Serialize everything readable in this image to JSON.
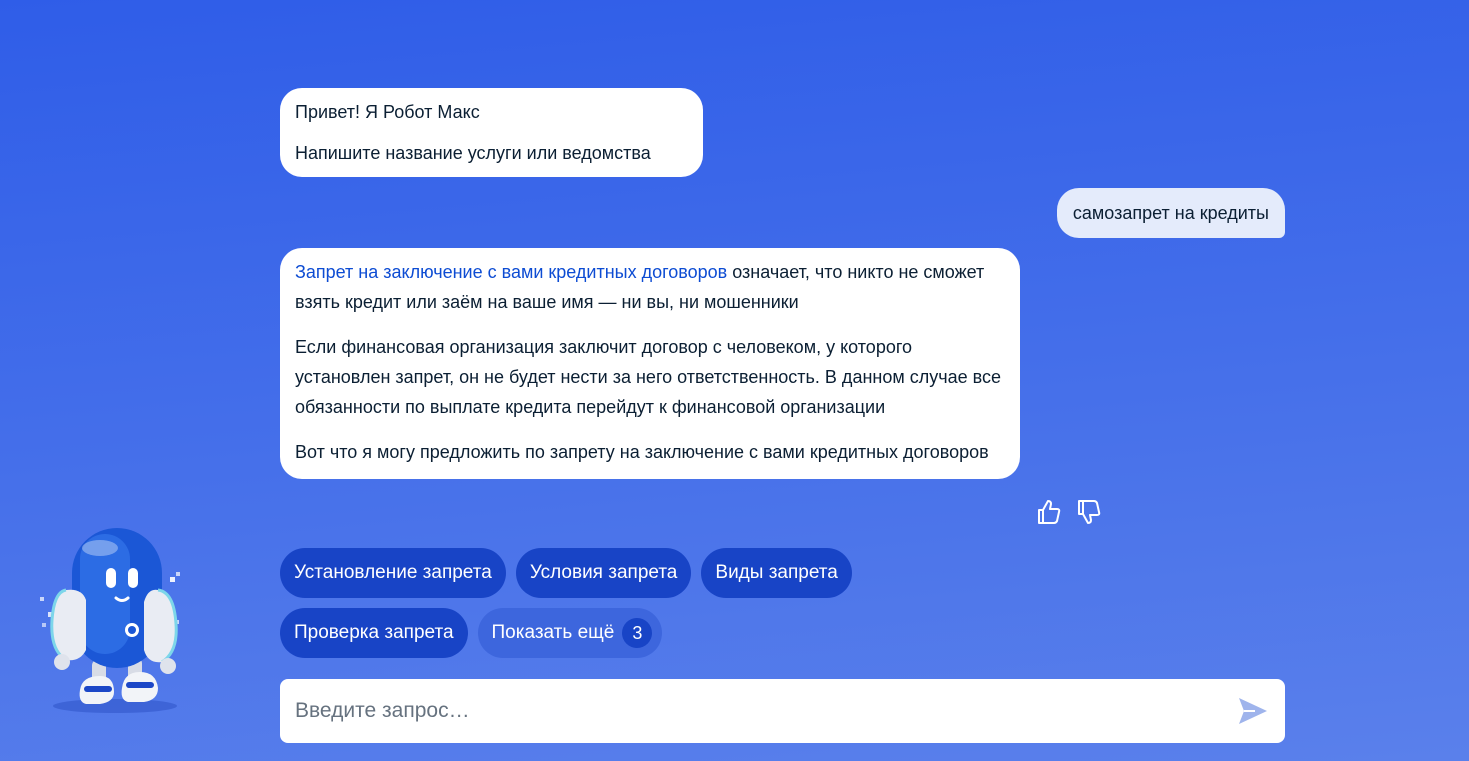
{
  "chat": {
    "greeting": {
      "line1": "Привет! Я Робот Макс",
      "line2": "Напишите название услуги или ведомства"
    },
    "user_message": "самозапрет на кредиты",
    "answer": {
      "link_text": "Запрет на заключение с вами кредитных договоров",
      "p1_rest": " означает, что никто не сможет взять кредит или заём на ваше имя — ни вы, ни мошенники",
      "p2": "Если финансовая организация заключит договор с человеком, у которого установлен запрет, он не будет нести за него ответственность. В данном случае все обязанности по выплате кредита перейдут к финансовой организации",
      "p3": "Вот что я могу предложить по запрету на заключение с вами кредитных договоров"
    }
  },
  "feedback": {
    "like_icon": "thumbs-up-icon",
    "dislike_icon": "thumbs-down-icon"
  },
  "chips": {
    "row1": [
      "Установление запрета",
      "Условия запрета",
      "Виды запрета"
    ],
    "row2": [
      "Проверка запрета"
    ],
    "more_label": "Показать ещё",
    "more_count": "3"
  },
  "input": {
    "placeholder": "Введите запрос…",
    "value": "",
    "send_icon": "send-icon"
  },
  "colors": {
    "background_top": "#2f5de8",
    "background_bottom": "#5a80eb",
    "chip": "#1844c6",
    "link": "#0d4cd3",
    "user_bubble": "#e4ebfb"
  },
  "assistant_avatar": "robot-max-mascot"
}
